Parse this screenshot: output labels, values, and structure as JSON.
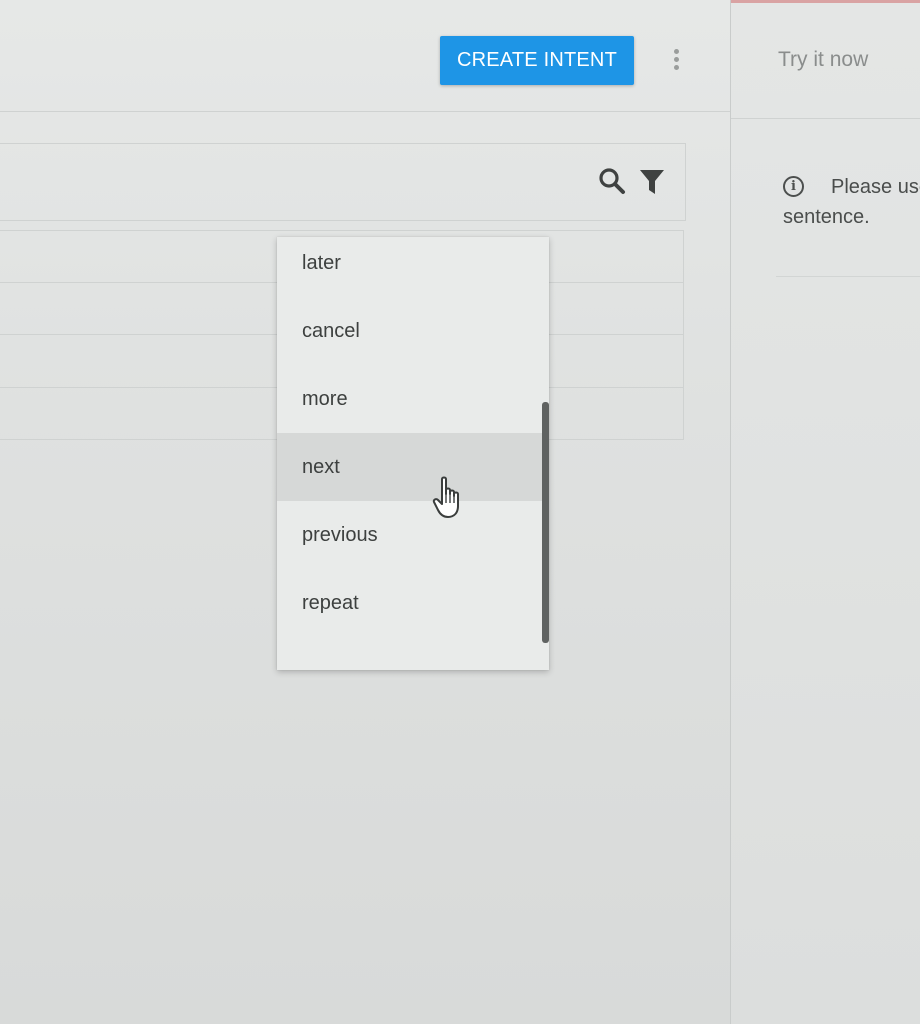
{
  "toolbar": {
    "create_intent_label": "CREATE INTENT",
    "more_icon": "more-vertical-icon"
  },
  "right_panel": {
    "try_now_label": "Try it now",
    "info_icon": "info-icon",
    "info_text_line1": "Please use",
    "info_text_line2": "sentence."
  },
  "search": {
    "search_icon": "search-icon",
    "filter_icon": "filter-icon"
  },
  "dropdown": {
    "items": [
      {
        "label": "later"
      },
      {
        "label": "cancel"
      },
      {
        "label": "more"
      },
      {
        "label": "next"
      },
      {
        "label": "previous"
      },
      {
        "label": "repeat"
      }
    ],
    "hovered_item": "next"
  },
  "colors": {
    "accent": "#1e95e6",
    "hover": "#d6d8d7"
  }
}
